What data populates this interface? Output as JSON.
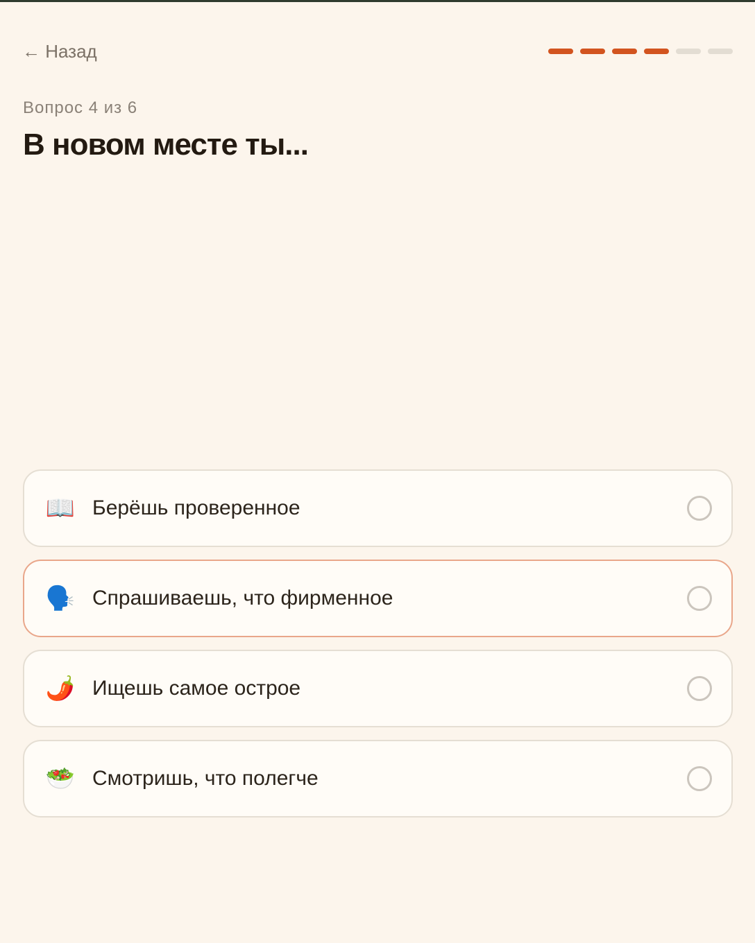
{
  "header": {
    "back_label": "← Назад",
    "progress": {
      "total": 6,
      "completed": 4,
      "active_color": "#d2541f",
      "inactive_color": "#e3ddd3"
    }
  },
  "question": {
    "counter": "Вопрос 4 из 6",
    "title": "В новом месте ты..."
  },
  "options": [
    {
      "icon": "open-book-icon",
      "emoji": "📖",
      "label": "Берёшь проверенное",
      "selected": false
    },
    {
      "icon": "speaking-head-icon",
      "emoji": "🗣️",
      "label": "Спрашиваешь, что фирменное",
      "selected": false
    },
    {
      "icon": "hot-pepper-icon",
      "emoji": "🌶️",
      "label": "Ищешь самое острое",
      "selected": false
    },
    {
      "icon": "salad-icon",
      "emoji": "🥗",
      "label": "Смотришь, что полегче",
      "selected": false
    }
  ],
  "colors": {
    "background": "#fcf5ec",
    "accent": "#d2541f",
    "hover_border": "#e9a68a"
  }
}
